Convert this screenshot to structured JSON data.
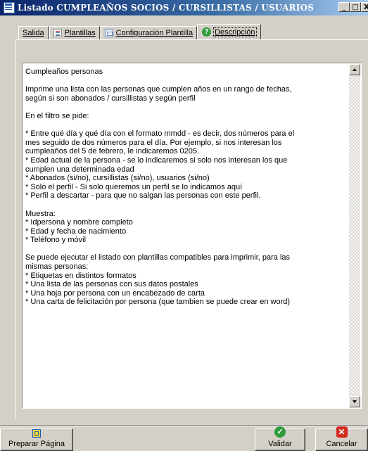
{
  "window": {
    "title": "Listado CUMPLEAÑOS SOCIOS / CURSILLISTAS / USUARIOS",
    "minimize": "_",
    "restore": "□",
    "close": "X"
  },
  "tabs": [
    {
      "label": "Salida"
    },
    {
      "label": "Plantillas"
    },
    {
      "label": "Configuración Plantilla"
    },
    {
      "label": "Descripción"
    }
  ],
  "description": {
    "text": "Cumpleaños personas\n\nImprime una lista con las personas que cumplen años en un rango de fechas,\nsegún si son abonados / cursillistas y según perfil\n\nEn el filtro se pide:\n\n* Entre qué día y qué día con el formato mmdd - es decir, dos números para el\nmes seguido de dos números para el día. Por ejemplo, si nos interesan los\ncumpleaños del 5 de febrero, le indicaremos 0205.\n* Edad actual de la persona - se lo indicaremos si solo nos interesan los que\ncumplen una determinada edad\n* Abonados (si/no), cursillistas (si/no), usuarios (si/no)\n* Solo el perfil - Si solo queremos un perfil se lo indicamos aquí\n* Perfil a descartar - para que no salgan las personas con este perfil.\n\nMuestra:\n* Idpersona y nombre completo\n* Edad y fecha de nacimiento\n* Teléfono y móvil\n\nSe puede ejecutar el listado con plantillas compatibles para imprimir, para las\nmismas personas:\n* Etiquetas en distintos formatos\n* Una lista de las personas con sus datos postales\n* Una hoja por persona con un encabezado de carta\n* Una carta de felicitación por persona (que tambien se puede crear en word)"
  },
  "buttons": {
    "prepare": "Preparar Página",
    "validate": "Validar",
    "cancel": "Cancelar"
  },
  "colors": {
    "window": "#d4d0c8",
    "titlebar": "#0a246a",
    "ok": "#2f9b3c",
    "cancel": "#d42a1f"
  }
}
